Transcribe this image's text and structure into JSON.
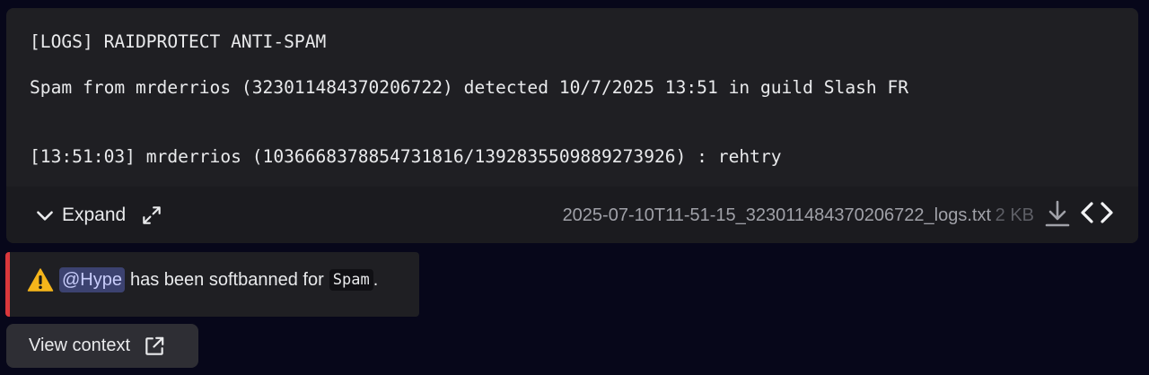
{
  "log_file": {
    "lines": [
      "[LOGS] RAIDPROTECT ANTI-SPAM",
      "Spam from mrderrios (323011484370206722) detected 10/7/2025 13:51 in guild Slash FR",
      "",
      "[13:51:03] mrderrios (1036668378854731816/1392835509889273926) : rehtry"
    ],
    "expand_label": "Expand",
    "filename": "2025-07-10T11-51-15_323011484370206722_logs.txt",
    "filesize": "2 KB"
  },
  "notice": {
    "icon": "warning-icon",
    "mention": "@Hype",
    "text": "has been softbanned for",
    "code": "Spam",
    "suffix": ".",
    "accent_color": "#da373c"
  },
  "view_context": {
    "label": "View context",
    "icon": "external-link-icon"
  }
}
